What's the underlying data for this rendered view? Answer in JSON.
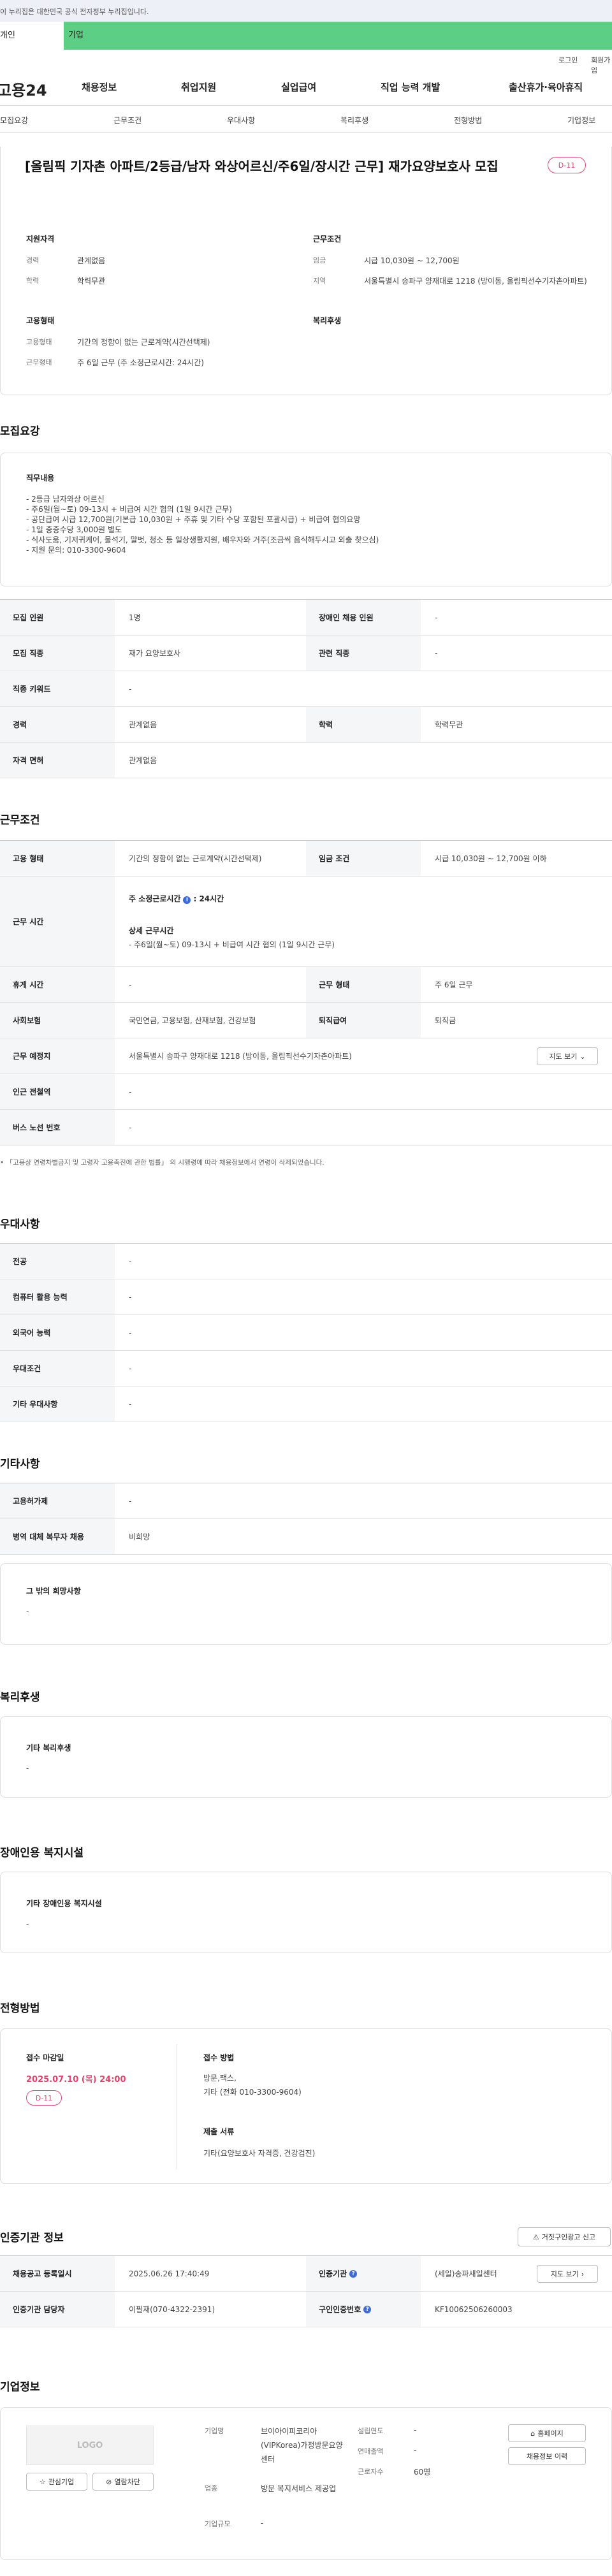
{
  "gov_banner": "이 누리집은 대한민국 공식 전자정부 누리집입니다.",
  "user_tabs": {
    "personal": "개인",
    "company": "기업"
  },
  "util": {
    "login": "로그인",
    "join": "회원가입"
  },
  "gnb": {
    "logo": "고용24",
    "menus": [
      "채용정보",
      "취업지원",
      "실업급여",
      "직업 능력 개발",
      "출산휴가·육아휴직"
    ]
  },
  "anchors": [
    "모집요강",
    "근무조건",
    "우대사항",
    "복리후생",
    "전형방법",
    "기업정보"
  ],
  "summary": {
    "title": "[올림픽 기자촌 아파트/2등급/남자 와상어르신/주6일/장시간 근무] 재가요양보호사 모집",
    "dday": "D-11",
    "qual_title": "지원자격",
    "career_k": "경력",
    "career_v": "관계없음",
    "edu_k": "학력",
    "edu_v": "학력무관",
    "emp_title": "고용형태",
    "emptype_k": "고용형태",
    "emptype_v": "기간의 정함이 없는 근로계약(시간선택제)",
    "worktype_k": "근무형태",
    "worktype_v": "주 6일 근무 (주 소정근로시간: 24시간)",
    "cond_title": "근무조건",
    "wage_k": "임금",
    "wage_v": "시급 10,030원 ~ 12,700원",
    "area_k": "지역",
    "area_v": "서울특별시 송파구 양재대로 1218 (방이동, 올림픽선수기자촌아파트)",
    "welfare_title": "복리후생"
  },
  "recruit": {
    "heading": "모집요강",
    "duty_label": "직무내용",
    "duty_text": "- 2등급 남자와상 어르신\n- 주6일(월~토) 09-13시 + 비급여 시간 협의 (1일 9시간 근무)\n- 공단급여 시급 12,700원(기본급 10,030원 + 주휴 및 기타 수당 포함된 포괄시급) + 비급여 협의요망\n- 1일 중증수당 3,000원 별도\n- 식사도움, 기저귀케어, 물석기, 말벗, 청소 등 일상생활지원, 배우자와 거주(조금씩 음식해두시고 외출 찾으심)\n- 지원 문의: 010-3300-9604",
    "rows": [
      {
        "k1": "모집 인원",
        "v1": "1명",
        "k2": "장애인 채용 인원",
        "v2": "-"
      },
      {
        "k1": "모집 직종",
        "v1": "재가 요양보호사",
        "k2": "관련 직종",
        "v2": "-"
      },
      {
        "k1": "직종 키워드",
        "v1": "-"
      },
      {
        "k1": "경력",
        "v1": "관계없음",
        "k2": "학력",
        "v2": "학력무관"
      },
      {
        "k1": "자격 면허",
        "v1": "관계없음"
      }
    ]
  },
  "conditions": {
    "heading": "근무조건",
    "emp_k": "고용 형태",
    "emp_v": "기간의 정함이 없는 근로계약(시간선택제)",
    "wage_k": "임금 조건",
    "wage_v": "시급 10,030원 ~ 12,700원 이하",
    "time_k": "근무 시간",
    "time_main_label": "주 소정근로시간",
    "time_main_val": ": 24시간",
    "time_detail_label": "상세 근무시간",
    "time_detail_val": "- 주6일(월~토) 09-13시 + 비급여 시간 협의 (1일 9시간 근무)",
    "rest_k": "휴게 시간",
    "rest_v": "-",
    "form_k": "근무 형태",
    "form_v": "주 6일 근무",
    "ins_k": "사회보험",
    "ins_v": "국민연금, 고용보험, 산재보험, 건강보험",
    "sev_k": "퇴직급여",
    "sev_v": "퇴직금",
    "place_k": "근무 예정지",
    "place_v": "서울특별시 송파구 양재대로 1218 (방이동, 올림픽선수기자촌아파트)",
    "map_btn": "지도 보기",
    "subway_k": "인근 전철역",
    "subway_v": "-",
    "bus_k": "버스 노선 번호",
    "bus_v": "-",
    "note": "「고용상 연령차별금지 및 고령자 고용촉진에 관한 법률」 의 시행령에 따라 채용정보에서 연령이 삭제되었습니다."
  },
  "prefer": {
    "heading": "우대사항",
    "rows": [
      {
        "k": "전공",
        "v": "-"
      },
      {
        "k": "컴퓨터 활용 능력",
        "v": "-"
      },
      {
        "k": "외국어 능력",
        "v": "-"
      },
      {
        "k": "우대조건",
        "v": "-"
      },
      {
        "k": "기타 우대사항",
        "v": "-"
      }
    ]
  },
  "etc": {
    "heading": "기타사항",
    "rows": [
      {
        "k": "고용허가제",
        "v": "-"
      },
      {
        "k": "병역 대체 복무자 채용",
        "v": "비희망"
      }
    ],
    "hope_label": "그 밖의 희망사항",
    "hope_v": "-"
  },
  "welfare": {
    "heading": "복리후생",
    "label": "기타 복리후생",
    "v": "-"
  },
  "disabled": {
    "heading": "장애인용 복지시설",
    "label": "기타 장애인용 복지시설",
    "v": "-"
  },
  "screening": {
    "heading": "전형방법",
    "deadline_label": "접수 마감일",
    "deadline": "2025.07.10 (목) 24:00",
    "dday": "D-11",
    "method_label": "접수 방법",
    "method_v": "방문,팩스,\n기타 (전화 010-3300-9604)",
    "docs_label": "제출 서류",
    "docs_v": "기타(요양보호사 자격증, 건강검진)"
  },
  "auth": {
    "heading": "인증기관 정보",
    "report_btn": "거짓구인광고 신고",
    "reg_k": "채용공고 등록일시",
    "reg_v": "2025.06.26 17:40:49",
    "org_k": "인증기관",
    "org_v": "(세일)송파새일센터",
    "map_btn": "지도 보기",
    "mgr_k": "인증기관 담당자",
    "mgr_v": "이필재(070-4322-2391)",
    "no_k": "구인인증번호",
    "no_v": "KF10062506260003"
  },
  "company": {
    "heading": "기업정보",
    "logo": "LOGO",
    "fav_btn": "관심기업",
    "block_btn": "열람차단",
    "name_k": "기업명",
    "name_v": "브이아이피코리아(VIPKorea)가정방문요양센터",
    "biz_k": "업종",
    "biz_v": "방문 복지서비스 제공업",
    "size_k": "기업규모",
    "size_v": "-",
    "est_k": "설립연도",
    "est_v": "-",
    "sales_k": "연매출액",
    "sales_v": "-",
    "emp_k": "근로자수",
    "emp_v": "60명",
    "home_btn": "홈페이지",
    "jobs_btn": "채용정보 이력"
  }
}
